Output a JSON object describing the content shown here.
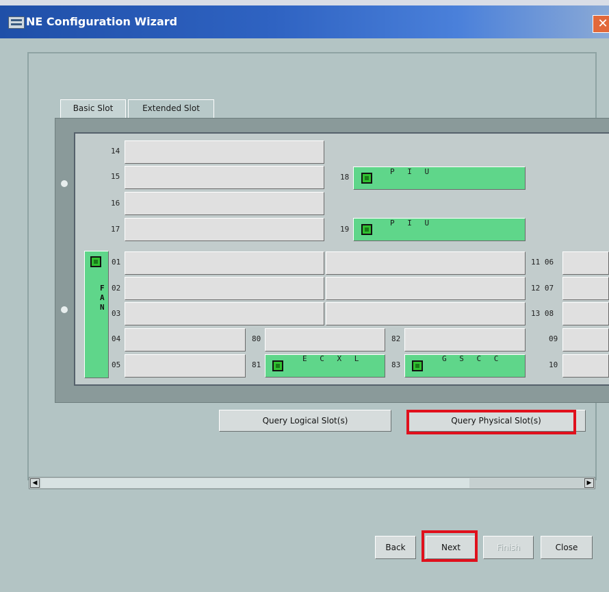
{
  "window": {
    "title": "NE Configuration Wizard",
    "close_glyph": "✕"
  },
  "tabs": [
    {
      "label": "Basic Slot",
      "selected": true
    },
    {
      "label": "Extended Slot",
      "selected": false
    }
  ],
  "slots": {
    "s14": "14",
    "s15": "15",
    "s16": "16",
    "s17": "17",
    "s18": "18",
    "s19": "19",
    "s01": "01",
    "s02": "02",
    "s03": "03",
    "s04": "04",
    "s05": "05",
    "s11_06": "11 06",
    "s12_07": "12 07",
    "s13_08": "13 08",
    "s09": "09",
    "s10": "10",
    "s80": "80",
    "s81": "81",
    "s82": "82",
    "s83": "83"
  },
  "boards": {
    "piu_18": "P I U",
    "piu_19": "P I U",
    "ecxl_81": "E C X L",
    "gscc_83": "G S C C"
  },
  "fan_letters": [
    "F",
    "A",
    "N"
  ],
  "buttons": {
    "query_logical": "Query Logical Slot(s)",
    "query_physical": "Query Physical Slot(s)",
    "back": "Back",
    "next": "Next",
    "finish": "Finish",
    "close": "Close"
  },
  "scrollbar": {
    "left_arrow": "◀",
    "right_arrow": "▶"
  },
  "colors": {
    "accent_title": "#1f4fa8",
    "board_green": "#5fd68a",
    "highlight_red": "#e0101c"
  }
}
